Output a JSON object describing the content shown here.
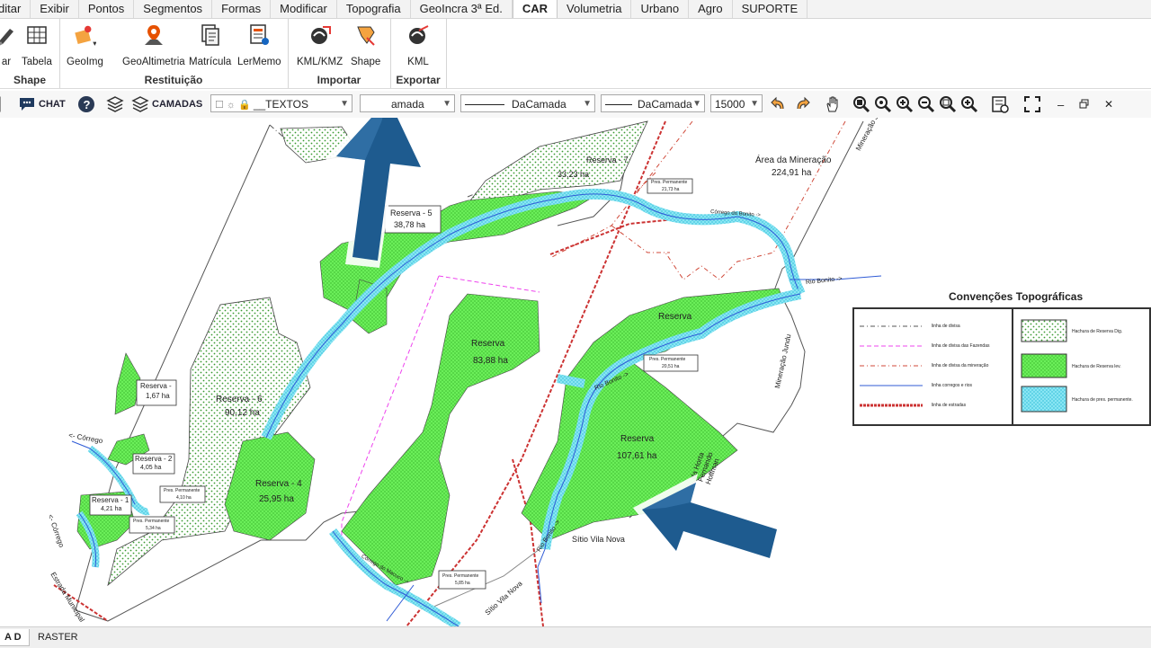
{
  "menu": {
    "tabs": [
      "ditar",
      "Exibir",
      "Pontos",
      "Segmentos",
      "Formas",
      "Modificar",
      "Topografia",
      "GeoIncra 3ª Ed.",
      "CAR",
      "Volumetria",
      "Urbano",
      "Agro",
      "SUPORTE"
    ],
    "active": "CAR"
  },
  "ribbon": {
    "shape_group": {
      "title": "Shape",
      "btn1": "ar",
      "btn2": "Tabela"
    },
    "restituicao_group": {
      "title": "Restituição",
      "btn1": "GeoImg",
      "btn2": "GeoAltimetria",
      "btn3": "Matrícula",
      "btn4": "LerMemo"
    },
    "importar_group": {
      "title": "Importar",
      "btn1": "KML/KMZ",
      "btn2": "Shape"
    },
    "exportar_group": {
      "title": "Exportar",
      "btn1": "KML"
    }
  },
  "toolbar": {
    "chat_label": "CHAT",
    "camadas_label": "CAMADAS",
    "layer_value": "__TEXTOS",
    "color_value": "amada",
    "linetype_value": "DaCamada",
    "lineweight_value": "DaCamada",
    "scale_value": "15000"
  },
  "map": {
    "area_mineracao": "Área da Mineração",
    "area_mineracao_ha": "224,91 ha",
    "mineracao_jundu_top": "Mineração Jundu",
    "mineracao_jundu_right": "Mineração Jundu",
    "rio_bonito": "Rio Bonito ->",
    "rio_bonito_mid": "Rio Bonito ->",
    "rio_bonito_low": "Rio Bonito ->",
    "corrego_bonito": "Córrego do Bonito ->",
    "corrego_left1": "<- Córrego",
    "corrego_left2": "<- Córrego",
    "corrego_macuco": "Córrego do Macuco ->",
    "estrada": "Estrada Municipal",
    "sitio_vila_nova": "Sítio Vila Nova",
    "sitio_vila_nova_road": "Sítio Vila Nova",
    "fazenda": "da Horta Fernando Hoffman",
    "reserva_7": "Reserva - 7",
    "reserva_7_ha": "33,23 ha",
    "reserva_5": "Reserva - 5",
    "reserva_5_ha": "38,78 ha",
    "reserva_6": "Reserva - 6",
    "reserva_6_ha": "90,12 ha",
    "reserva_4": "Reserva - 4",
    "reserva_4_ha": "25,95 ha",
    "reserva_1b": "Reserva -",
    "reserva_1b_ha": "1,67 ha",
    "reserva_2": "Reserva - 2",
    "reserva_2_ha": "4,05 ha",
    "reserva_1": "Reserva - 1",
    "reserva_1_ha": "4,21 ha",
    "reserva_center": "Reserva",
    "reserva_center_ha": "83,88 ha",
    "reserva_right_top": "Reserva",
    "reserva_right": "Reserva",
    "reserva_right_ha": "107,61 ha",
    "pp_top": "Pres. Permanente",
    "pp_top_ha": "21,73 ha",
    "pp_right": "Pres. Permanente",
    "pp_right_ha": "20,51 ha",
    "pp_left1": "Pres. Permanente",
    "pp_left1_ha": "4,10 ha",
    "pp_left2": "Pres. Permanente",
    "pp_left2_ha": "5,34 ha",
    "pp_bottom": "Pres. Permanente",
    "pp_bottom_ha": "5,85 ha"
  },
  "legend": {
    "title": "Convenções Topográficas",
    "lines": [
      "linha de divisa",
      "linha de divisa das Fazendas",
      "linha de divisa da mineração",
      "linha corregos e rios",
      "linha de estradas"
    ],
    "hatches": [
      "Hachura de Reserva Dig.",
      "Hachura de Reserva lev.",
      "Hachura de pres. permanente."
    ]
  },
  "bottom": {
    "tabs": [
      "A D",
      "RASTER"
    ]
  },
  "colors": {
    "reserve": "#66ee55",
    "river": "#5fd6ee",
    "arrow": "#1e5b8f",
    "boundary": "#555555"
  }
}
